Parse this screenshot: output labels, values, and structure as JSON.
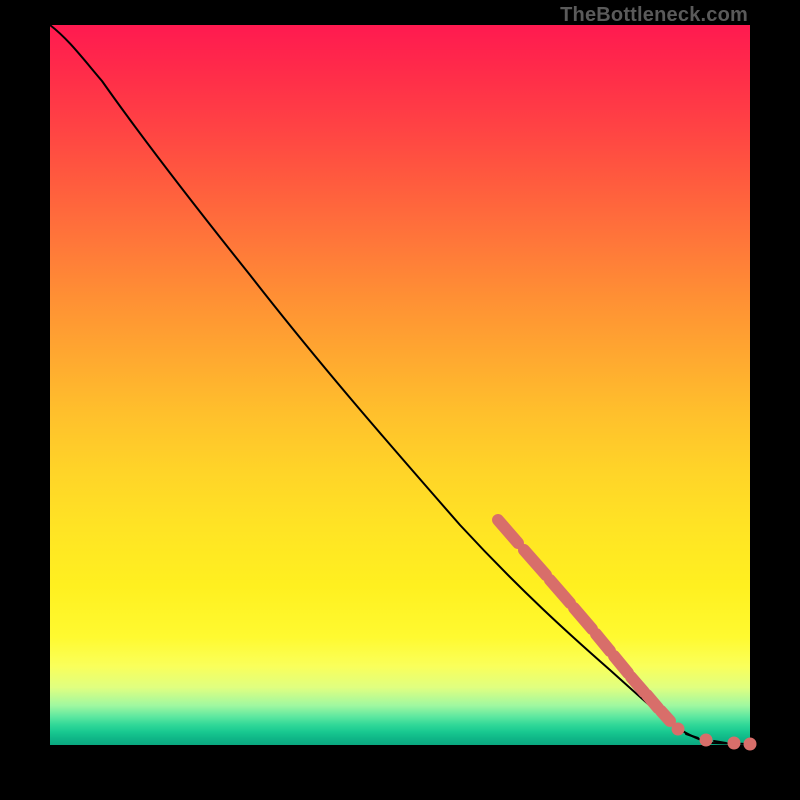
{
  "watermark": "TheBottleneck.com",
  "chart_data": {
    "type": "line",
    "title": "",
    "xlabel": "",
    "ylabel": "",
    "xlim": [
      0,
      100
    ],
    "ylim": [
      0,
      100
    ],
    "series": [
      {
        "name": "curve",
        "x": [
          0,
          4,
          8,
          12,
          18,
          26,
          34,
          42,
          50,
          58,
          64,
          70,
          76,
          82,
          86,
          88,
          90,
          92,
          94,
          96,
          98,
          100
        ],
        "y": [
          100,
          98,
          95.5,
          92,
          85,
          75,
          65,
          55,
          45,
          35,
          28,
          21,
          14,
          8,
          4,
          2.8,
          1.8,
          1.0,
          0.5,
          0.25,
          0.1,
          0.05
        ]
      }
    ],
    "highlight_range_x": [
      64,
      88
    ],
    "tail_markers_x": [
      90,
      93,
      96,
      100
    ]
  }
}
